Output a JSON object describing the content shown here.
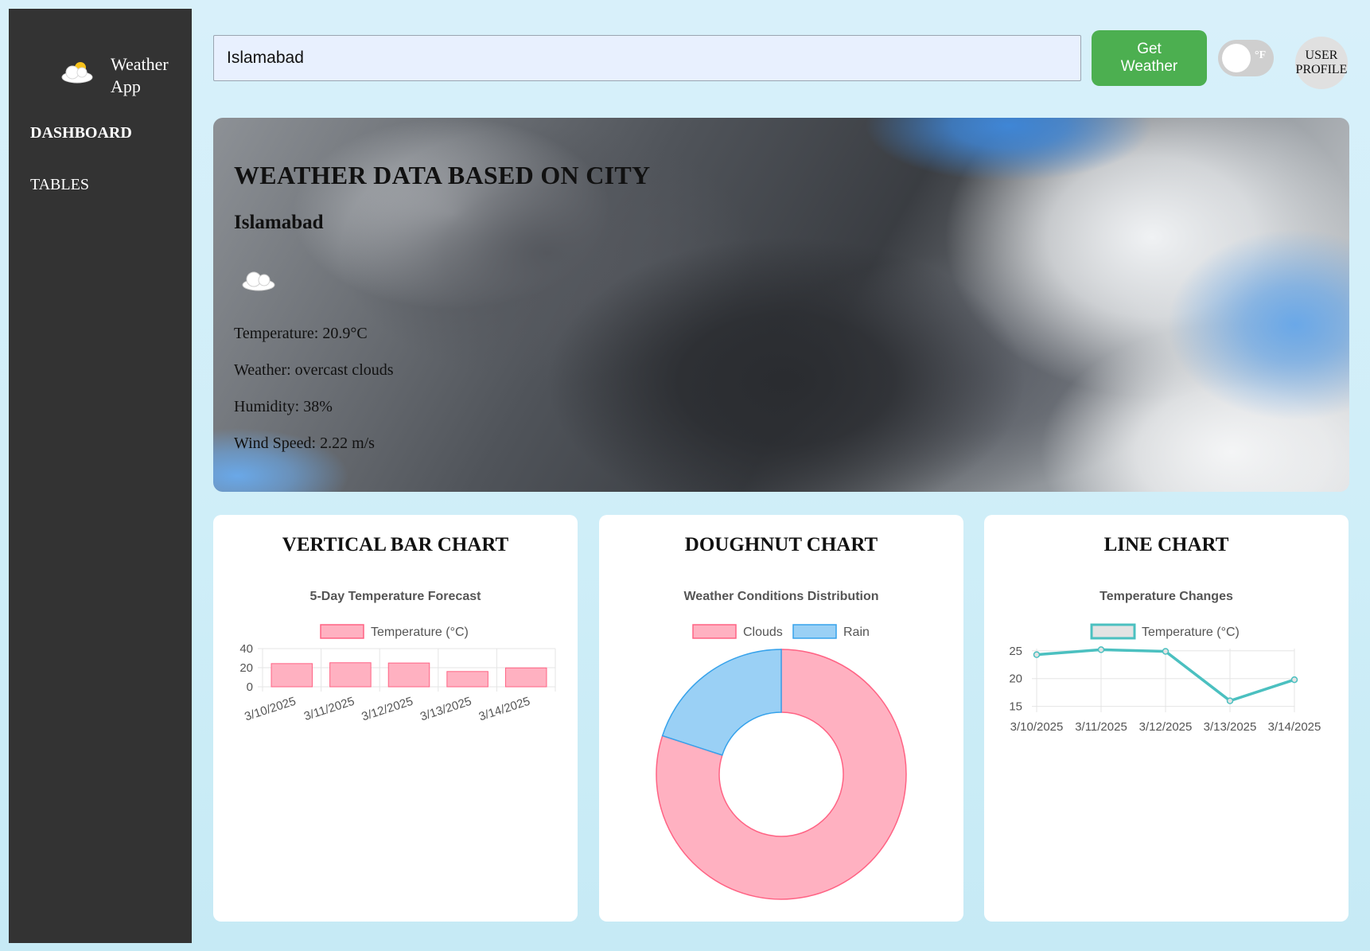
{
  "app": {
    "name": "Weather App",
    "nav": {
      "dashboard": "DASHBOARD",
      "tables": "TABLES"
    }
  },
  "topbar": {
    "city_value": "Islamabad",
    "get_weather_label": "Get Weather",
    "unit_toggle_label": "°F",
    "profile_label": "USER PROFILE"
  },
  "hero": {
    "title": "WEATHER DATA BASED ON CITY",
    "city": "Islamabad",
    "condition_icon": "cloud-icon",
    "temperature": "Temperature: 20.9°C",
    "weather": "Weather: overcast clouds",
    "humidity": "Humidity: 38%",
    "wind": "Wind Speed: 2.22 m/s"
  },
  "cards": {
    "bar_title": "VERTICAL BAR CHART",
    "doughnut_title": "DOUGHNUT CHART",
    "line_title": "LINE CHART"
  },
  "chart_data": [
    {
      "type": "bar",
      "title": "5-Day Temperature Forecast",
      "categories": [
        "3/10/2025",
        "3/11/2025",
        "3/12/2025",
        "3/13/2025",
        "3/14/2025"
      ],
      "series": [
        {
          "name": "Temperature (°C)",
          "values": [
            24.3,
            25.2,
            24.9,
            16.0,
            19.8
          ]
        }
      ],
      "yticks": [
        0,
        20,
        40
      ],
      "ylim": [
        0,
        40
      ],
      "colors": {
        "fill": "#ffb1c1",
        "stroke": "#ff6384"
      },
      "grid": true,
      "legend": "top"
    },
    {
      "type": "pie",
      "variant": "doughnut",
      "title": "Weather Conditions Distribution",
      "labels": [
        "Clouds",
        "Rain"
      ],
      "values": [
        4,
        1
      ],
      "colors": [
        "#ffb1c1",
        "#9ad0f5"
      ],
      "stroke_colors": [
        "#ff6384",
        "#36a2eb"
      ],
      "legend": "top"
    },
    {
      "type": "line",
      "title": "Temperature Changes",
      "x": [
        "3/10/2025",
        "3/11/2025",
        "3/12/2025",
        "3/13/2025",
        "3/14/2025"
      ],
      "series": [
        {
          "name": "Temperature (°C)",
          "values": [
            24.3,
            25.2,
            24.9,
            16.0,
            19.8
          ]
        }
      ],
      "yticks": [
        15,
        20,
        25
      ],
      "ylim": [
        14.8,
        25.4
      ],
      "colors": {
        "line": "#4bc0c0"
      },
      "grid": true,
      "legend": "top"
    }
  ]
}
